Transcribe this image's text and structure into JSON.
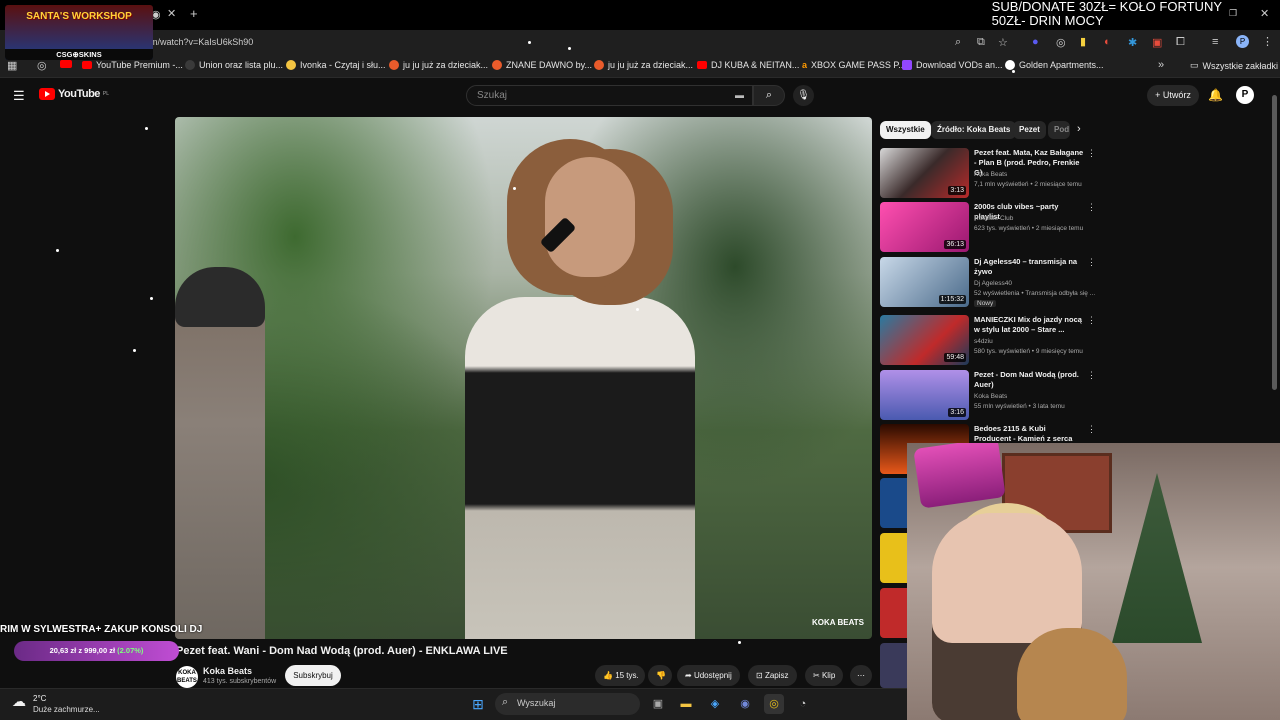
{
  "stream_overlay": {
    "donate_line1": "SUB/DONATE 30ZŁ= KOŁO FORTUNY",
    "donate_line2": "50ZŁ- DRIN MOCY",
    "logo_title": "SANTA'S WORKSHOP",
    "logo_sub": "CSG⊕SKINS",
    "goal_text": "RIM W SYLWESTRA+ ZAKUP KONSOLI DJ",
    "goal_amount": "20,63 zł z 999,00 zł",
    "goal_percent": "(2.07%)",
    "goal_progress": 0.0207
  },
  "browser": {
    "url": "m/watch?v=KaIsU6kSh90",
    "bookmarks": [
      {
        "label": "YouTube Premium -...",
        "color": "#ff0000"
      },
      {
        "label": "Union oraz lista plu...",
        "color": "#3a3a3a"
      },
      {
        "label": "Ivonka - Czytaj i słu...",
        "color": "#f4c542"
      },
      {
        "label": "ju ju już za dzieciak...",
        "color": "#e95b2b"
      },
      {
        "label": "ZNANE DAWNO by...",
        "color": "#e95b2b"
      },
      {
        "label": "ju ju już za dzieciak...",
        "color": "#e95b2b"
      },
      {
        "label": "DJ KUBA & NEITAN...",
        "color": "#ff0000"
      },
      {
        "label": "XBOX GAME PASS P...",
        "color": "#ff9900"
      },
      {
        "label": "Download VODs an...",
        "color": "#9147ff"
      },
      {
        "label": "Golden Apartments...",
        "color": "#ffffff"
      }
    ],
    "all_bookmarks": "Wszystkie zakładki"
  },
  "youtube": {
    "logo": "YouTube",
    "logo_region": "PL",
    "search_placeholder": "Szukaj",
    "create_label": "Utwórz",
    "video": {
      "title": "Pezet feat. Wani - Dom Nad Wodą (prod. Auer) - ENKLAWA LIVE",
      "watermark": "KOKA BEATS",
      "channel": "Koka Beats",
      "channel_avatar": "KOKA BEATS",
      "subscribers": "413 tys. subskrybentów",
      "subscribe_label": "Subskrybuj",
      "likes": "15 tys.",
      "share_label": "Udostępnij",
      "save_label": "Zapisz",
      "clip_label": "Klip"
    },
    "chips": [
      "Wszystkie",
      "Źródło: Koka Beats",
      "Pezet",
      "Pod"
    ],
    "recommendations": [
      {
        "title": "Pezet feat. Mata, Kaz Bałagane - Plan B (prod. Pedro, Frenkie G)",
        "channel": "Koka Beats",
        "meta": "7,1 mln wyświetleń • 2 miesiące temu",
        "duration": "3:13",
        "color": "#3a2a2a"
      },
      {
        "title": "2000s club vibes ~party playlist",
        "channel": "Roseate Club",
        "meta": "623 tys. wyświetleń • 2 miesiące temu",
        "duration": "36:13",
        "color": "#c2187a"
      },
      {
        "title": "Dj Ageless40 – transmisja na żywo",
        "channel": "Dj Ageless40",
        "meta": "52 wyświetlenia • Transmisja odbyła się ...",
        "badge": "Nowy",
        "duration": "1:15:32",
        "color": "#4a6a8a"
      },
      {
        "title": "MANIECZKI Mix do jazdy nocą w stylu lat 2000 – Stare ...",
        "channel": "s4dziu",
        "meta": "580 tys. wyświetleń • 9 miesięcy temu",
        "duration": "59:48",
        "color": "#1f5a7a"
      },
      {
        "title": "Pezet - Dom Nad Wodą (prod. Auer)",
        "channel": "Koka Beats",
        "meta": "55 mln wyświetleń • 3 lata temu",
        "duration": "3:16",
        "color": "#6a5ab0"
      },
      {
        "title": "Bedoes 2115 & Kubi Producent - Kamień z serca",
        "channel": "",
        "meta": "",
        "duration": "",
        "color": "#8a2a10"
      }
    ]
  },
  "taskbar": {
    "weather_temp": "2°C",
    "weather_desc": "Duże zachmurze...",
    "search_placeholder": "Wyszukaj"
  },
  "colors": {
    "yt_red": "#ff0000",
    "background": "#0f0f0f",
    "goal_bar": "#c04dd4"
  }
}
